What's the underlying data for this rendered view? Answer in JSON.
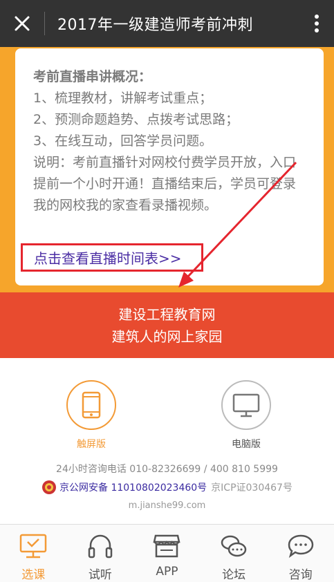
{
  "header": {
    "title": "2017年一级建造师考前冲刺",
    "close_icon": "close-icon",
    "more_icon": "more-vertical-icon"
  },
  "intro_card": {
    "heading": "考前直播串讲概况：",
    "items": [
      "1、梳理教材，讲解考试重点；",
      "2、预测命题趋势、点拨考试思路；",
      "3、在线互动，回答学员问题。"
    ],
    "note": "说明：考前直播针对网校付费学员开放，入口提前一个小时开通！直播结束后，学员可登录我的网校我的家查看录播视频。",
    "schedule_link": "点击查看直播时间表>>"
  },
  "banner": {
    "line1": "建设工程教育网",
    "line2": "建筑人的网上家园"
  },
  "versions": {
    "touch_label": "触屏版",
    "desktop_label": "电脑版"
  },
  "footer": {
    "hotline": "24小时咨询电话 010-82326699 / 400 810 5999",
    "police_record": "京公网安备 11010802023460号",
    "icp": "京ICP证030467号",
    "domain": "m.jianshe99.com"
  },
  "tabs": [
    {
      "label": "选课",
      "icon": "monitor-icon",
      "active": true
    },
    {
      "label": "试听",
      "icon": "headphones-icon",
      "active": false
    },
    {
      "label": "APP",
      "icon": "store-icon",
      "active": false
    },
    {
      "label": "论坛",
      "icon": "chat-bubbles-icon",
      "active": false
    },
    {
      "label": "咨询",
      "icon": "speech-bubble-icon",
      "active": false
    }
  ],
  "colors": {
    "topbar": "#333333",
    "orange_bg": "#f6a52b",
    "banner_red": "#e84b2f",
    "accent_orange": "#f39a36",
    "highlight_red": "#e5252e",
    "link_purple": "#4b2ea4"
  }
}
